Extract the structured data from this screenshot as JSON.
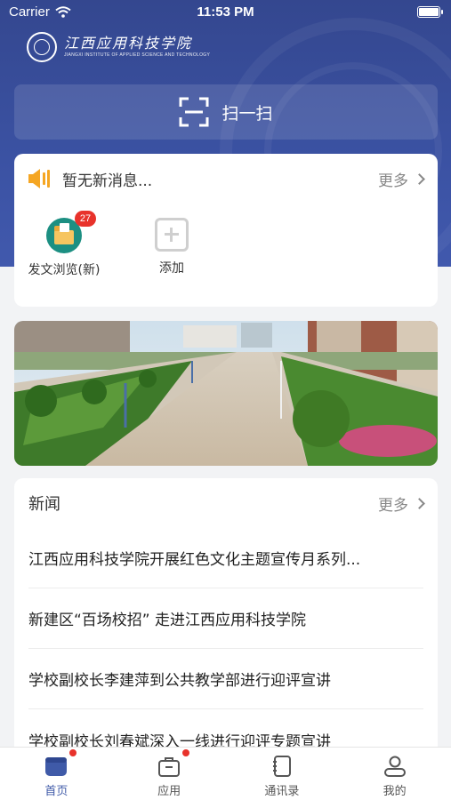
{
  "status_bar": {
    "carrier": "Carrier",
    "time": "11:53 PM"
  },
  "header": {
    "logo_cn": "江西应用科技学院",
    "logo_en": "JIANGXI INSTITUTE OF APPLIED SCIENCE AND TECHNOLOGY",
    "scan_label": "扫一扫"
  },
  "messages": {
    "text": "暂无新消息...",
    "more_label": "更多"
  },
  "apps": [
    {
      "label": "发文浏览(新)",
      "badge": "27",
      "icon": "folder-icon"
    },
    {
      "label": "添加",
      "icon": "add-icon"
    }
  ],
  "news": {
    "title": "新闻",
    "more_label": "更多",
    "items": [
      "江西应用科技学院开展红色文化主题宣传月系列...",
      "新建区“百场校招” 走进江西应用科技学院",
      "学校副校长李建萍到公共教学部进行迎评宣讲",
      "学校副校长刘春斌深入一线进行迎评专题宣讲"
    ]
  },
  "tabbar": [
    {
      "label": "首页",
      "icon": "home-icon",
      "active": true,
      "dot": true
    },
    {
      "label": "应用",
      "icon": "briefcase-icon",
      "active": false,
      "dot": true
    },
    {
      "label": "通讯录",
      "icon": "contacts-book-icon",
      "active": false,
      "dot": false
    },
    {
      "label": "我的",
      "icon": "person-icon",
      "active": false,
      "dot": false
    }
  ],
  "colors": {
    "primary": "#3b52a3",
    "badge": "#e8322b",
    "speaker": "#f5a623",
    "app_teal": "#1c8f82"
  }
}
